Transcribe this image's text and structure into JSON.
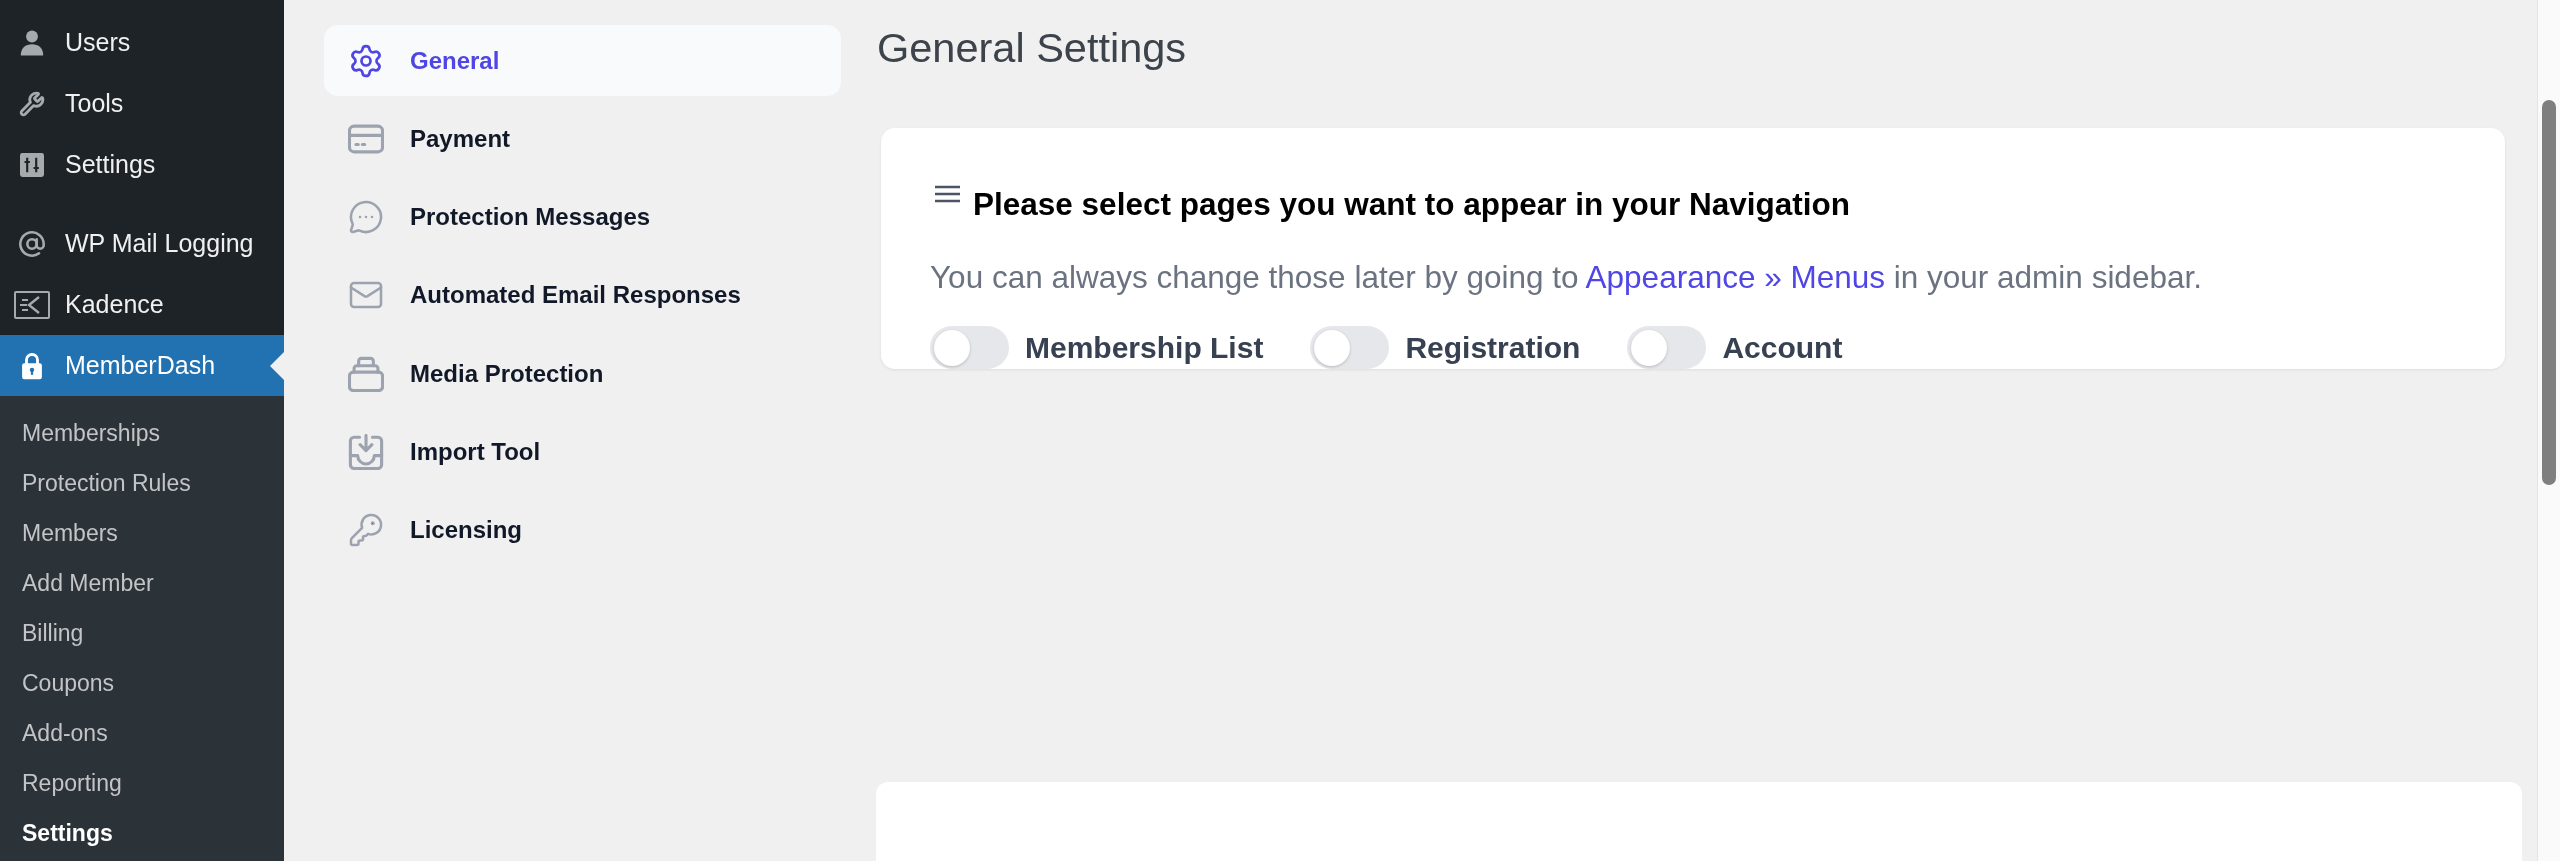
{
  "admin_menu": {
    "sections": [
      {
        "items": [
          {
            "label": "Users",
            "selected": false
          },
          {
            "label": "Tools",
            "selected": false
          },
          {
            "label": "Settings",
            "selected": false
          }
        ]
      },
      {
        "items": [
          {
            "label": "WP Mail Logging",
            "selected": false
          },
          {
            "label": "Kadence",
            "selected": false
          },
          {
            "label": "MemberDash",
            "selected": true,
            "submenu": [
              {
                "label": "Memberships",
                "selected": false
              },
              {
                "label": "Protection Rules",
                "selected": false
              },
              {
                "label": "Members",
                "selected": false
              },
              {
                "label": "Add Member",
                "selected": false
              },
              {
                "label": "Billing",
                "selected": false
              },
              {
                "label": "Coupons",
                "selected": false
              },
              {
                "label": "Add-ons",
                "selected": false
              },
              {
                "label": "Reporting",
                "selected": false
              },
              {
                "label": "Settings",
                "selected": true
              }
            ]
          }
        ]
      }
    ]
  },
  "settings_nav": {
    "items": [
      {
        "label": "General",
        "selected": true
      },
      {
        "label": "Payment",
        "selected": false
      },
      {
        "label": "Protection Messages",
        "selected": false
      },
      {
        "label": "Automated Email Responses",
        "selected": false
      },
      {
        "label": "Media Protection",
        "selected": false
      },
      {
        "label": "Import Tool",
        "selected": false
      },
      {
        "label": "Licensing",
        "selected": false
      }
    ]
  },
  "page_title": "General Settings",
  "navigation_card": {
    "heading": "Please select pages you want to appear in your Navigation",
    "description": {
      "before": "You can always change those later by going to",
      "link": "Appearance » Menus",
      "after": "in your admin sidebar."
    },
    "toggles": [
      {
        "label": "Membership List",
        "on": false
      },
      {
        "label": "Registration",
        "on": false
      },
      {
        "label": "Account",
        "on": false
      }
    ]
  }
}
